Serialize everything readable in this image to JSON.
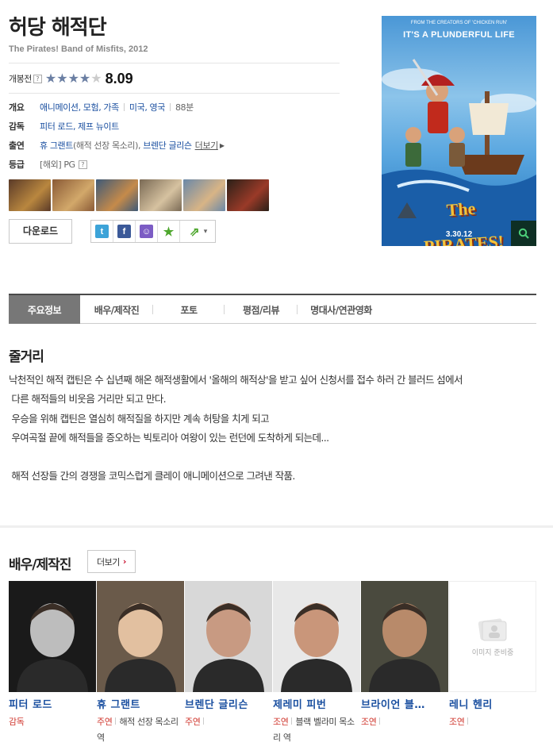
{
  "movie": {
    "title": "허당 해적단",
    "subtitle": "The Pirates! Band of Misfits, 2012",
    "rating_label": "개봉전",
    "rating_help": "?",
    "rating_score": "8.09",
    "rating_stars": 4
  },
  "info": {
    "genre_label": "개요",
    "genres": "애니메이션, 모험, 가족",
    "countries": "미국, 영국",
    "runtime": "88분",
    "director_label": "감독",
    "directors": "피터 로드, 제프 뉴이트",
    "cast_label": "출연",
    "cast_1_name": "휴 그랜트",
    "cast_1_role": "(해적 선장 목소리)",
    "cast_2_name": "브렌단 글리슨",
    "cast_more": "더보기",
    "grade_label": "등급",
    "grade_value": "[해외] PG",
    "grade_help": "?"
  },
  "thumbnails": [
    {
      "colors": [
        "#5a3a28",
        "#b9873f"
      ]
    },
    {
      "colors": [
        "#8a5a36",
        "#d2a86a"
      ]
    },
    {
      "colors": [
        "#3e5a78",
        "#c58a4a"
      ]
    },
    {
      "colors": [
        "#7a6a55",
        "#d6c2a0"
      ]
    },
    {
      "colors": [
        "#6a88a8",
        "#d8b486"
      ]
    },
    {
      "colors": [
        "#2a2018",
        "#9a3a28"
      ]
    }
  ],
  "actions": {
    "download_label": "다운로드",
    "share": [
      {
        "icon": "twitter-icon",
        "glyph": "t",
        "color": "#3ca3d8"
      },
      {
        "icon": "facebook-icon",
        "glyph": "f",
        "color": "#3b5998"
      },
      {
        "icon": "messenger-icon",
        "glyph": "☺",
        "color": "#7c5cc4"
      },
      {
        "icon": "favorite-star-icon",
        "glyph": "★",
        "color": "#4ea72e"
      },
      {
        "icon": "share-out-icon",
        "glyph": "⇗",
        "color": "#4ea72e"
      }
    ]
  },
  "poster": {
    "top_small": "FROM THE CREATORS OF 'CHICKEN RUN'",
    "tagline": "IT'S A PLUNDERFUL LIFE",
    "logo": "The PIRATES!",
    "date": "3.30.12"
  },
  "tabs": [
    {
      "label": "주요정보",
      "active": true
    },
    {
      "label": "배우/제작진",
      "active": false
    },
    {
      "label": "포토",
      "active": false
    },
    {
      "label": "평점/리뷰",
      "active": false
    },
    {
      "label": "명대사/연관영화",
      "active": false
    }
  ],
  "synopsis": {
    "heading": "줄거리",
    "text": "낙천적인 해적 캡틴은 수 십년째 해온 해적생활에서 '올해의 해적상'을 받고 싶어 신청서를 접수 하러 간 블러드 섬에서\n 다른 해적들의 비웃음 거리만 되고 만다.\n 우승을 위해 캡틴은 열심히 해적질을 하지만 계속 허탕을 치게 되고\n 우여곡절 끝에 해적들을 증오하는 빅토리아 여왕이 있는 런던에 도착하게 되는데...\n\n 해적 선장들 간의 경쟁을 코믹스럽게 클레이 애니메이션으로 그려낸 작품."
  },
  "crew": {
    "heading": "배우/제작진",
    "more_label": "더보기",
    "people": [
      {
        "name": "피터 로드",
        "role": "감독",
        "character": "",
        "photo": [
          "#1a1a1a",
          "#bdbdbd"
        ],
        "no_image": false
      },
      {
        "name": "휴 그랜트",
        "role": "주연",
        "character": "해적 선장 목소리 역",
        "photo": [
          "#6a5a4a",
          "#e2c0a0"
        ],
        "no_image": false
      },
      {
        "name": "브렌단 글리슨",
        "role": "주연",
        "character": "",
        "photo": [
          "#d8d8d8",
          "#c89a82"
        ],
        "no_image": false
      },
      {
        "name": "제레미 피번",
        "role": "조연",
        "character": "블랙 벨라미 목소리 역",
        "photo": [
          "#e8e8e8",
          "#c9967a"
        ],
        "no_image": false
      },
      {
        "name": "브라이언 블…",
        "role": "조연",
        "character": "",
        "photo": [
          "#4a4a3e",
          "#b88a6a"
        ],
        "no_image": false
      },
      {
        "name": "레니 헨리",
        "role": "조연",
        "character": "",
        "photo": [
          "#ffffff",
          "#ffffff"
        ],
        "no_image": true,
        "no_image_text": "이미지 준비중"
      }
    ]
  }
}
